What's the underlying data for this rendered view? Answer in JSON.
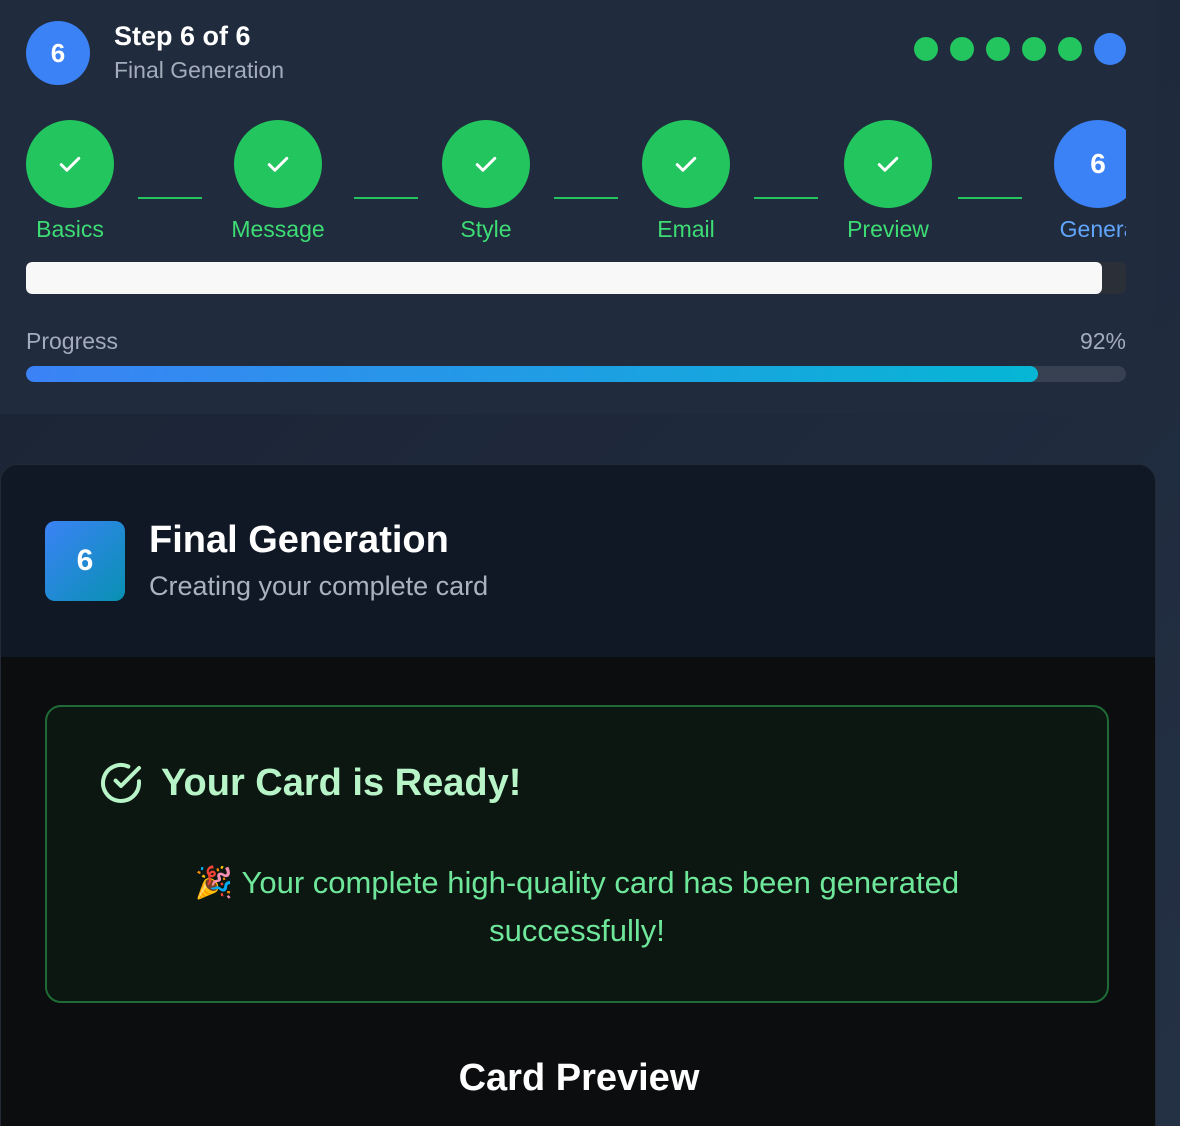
{
  "header": {
    "badge": "6",
    "step_counter": "Step 6 of 6",
    "step_title": "Final Generation",
    "dots": [
      "done",
      "done",
      "done",
      "done",
      "done",
      "active"
    ]
  },
  "stepper": {
    "steps": [
      {
        "label": "Basics",
        "state": "done",
        "icon": "check-icon"
      },
      {
        "label": "Message",
        "state": "done",
        "icon": "check-icon"
      },
      {
        "label": "Style",
        "state": "done",
        "icon": "check-icon"
      },
      {
        "label": "Email",
        "state": "done",
        "icon": "check-icon"
      },
      {
        "label": "Preview",
        "state": "done",
        "icon": "check-icon"
      },
      {
        "label": "Genera",
        "state": "current",
        "number": "6"
      }
    ]
  },
  "upper_bar": {
    "fill_fraction": 0.978
  },
  "progress": {
    "label": "Progress",
    "value_text": "92%",
    "value": 92
  },
  "card": {
    "badge": "6",
    "title": "Final Generation",
    "subtitle": "Creating your complete card"
  },
  "success": {
    "icon": "check-circle-icon",
    "title": "Your Card is Ready!",
    "message": "🎉 Your complete high-quality card has been generated successfully!"
  },
  "preview": {
    "title": "Card Preview"
  },
  "colors": {
    "accent_blue": "#3b82f6",
    "success_green": "#22c55e",
    "cyan": "#06b6d4"
  }
}
